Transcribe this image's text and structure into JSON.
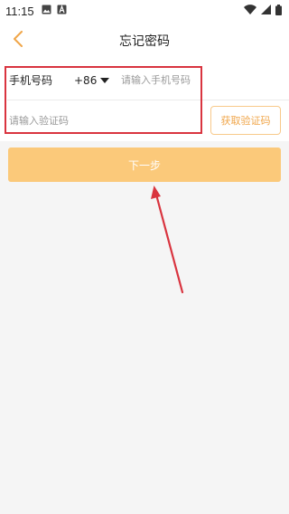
{
  "status_bar": {
    "time": "11:15",
    "left_icons": [
      "image-icon",
      "a-letter-icon"
    ],
    "right_icons": [
      "wifi-icon",
      "cellular-signal-icon",
      "battery-icon"
    ]
  },
  "nav": {
    "title": "忘记密码",
    "back_icon": "chevron-left-icon",
    "accent_color": "#f0a64a"
  },
  "form": {
    "phone_label": "手机号码",
    "country_code": "+86",
    "phone_placeholder": "请输入手机号码",
    "phone_value": "",
    "code_placeholder": "请输入验证码",
    "code_value": "",
    "get_code_label": "获取验证码"
  },
  "actions": {
    "next_label": "下一步",
    "next_color": "#fbc97a"
  },
  "annotation": {
    "highlight_color": "#d9343f",
    "arrow_color": "#d9343f"
  }
}
